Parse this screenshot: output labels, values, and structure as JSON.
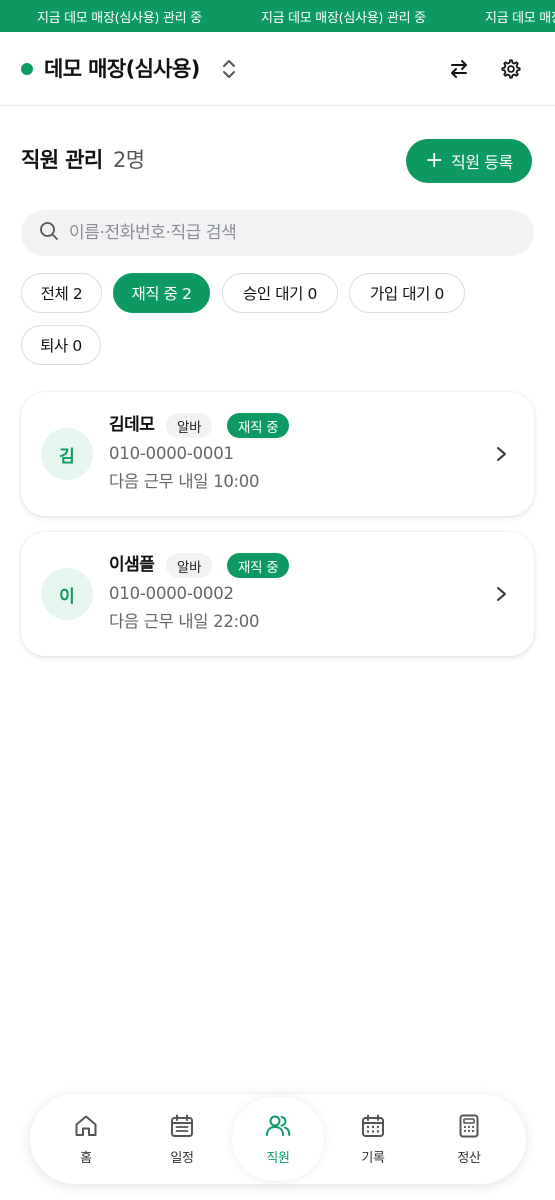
{
  "banner": {
    "items": [
      "지금 데모 매장(심사용) 관리 중",
      "지금 데모 매장(심사용) 관리 중",
      "지금 데모 매장(심사용) 관리 중"
    ]
  },
  "header": {
    "store_name": "데모 매장(심사용)",
    "switch_icon": "swap-arrows-icon",
    "settings_icon": "gear-icon"
  },
  "page": {
    "title": "직원 관리",
    "count": "2명",
    "add_button_label": "직원 등록"
  },
  "search": {
    "placeholder": "이름·전화번호·직급 검색",
    "value": ""
  },
  "filters": [
    {
      "label": "전체 2",
      "active": false
    },
    {
      "label": "재직 중 2",
      "active": true
    },
    {
      "label": "승인 대기 0",
      "active": false
    },
    {
      "label": "가입 대기 0",
      "active": false
    },
    {
      "label": "퇴사 0",
      "active": false
    }
  ],
  "employees": [
    {
      "initial": "김",
      "name": "김데모",
      "role": "알바",
      "status": "재직 중",
      "phone": "010-0000-0001",
      "next_shift": "다음 근무 내일 10:00"
    },
    {
      "initial": "이",
      "name": "이샘플",
      "role": "알바",
      "status": "재직 중",
      "phone": "010-0000-0002",
      "next_shift": "다음 근무 내일 22:00"
    }
  ],
  "nav": {
    "items": [
      {
        "label": "홈",
        "icon": "home-icon",
        "active": false
      },
      {
        "label": "일정",
        "icon": "calendar-icon",
        "active": false
      },
      {
        "label": "직원",
        "icon": "users-icon",
        "active": true
      },
      {
        "label": "기록",
        "icon": "calendar-grid-icon",
        "active": false
      },
      {
        "label": "정산",
        "icon": "calculator-icon",
        "active": false
      }
    ]
  },
  "colors": {
    "accent": "#0c9a62",
    "avatar_bg": "#e6f5ee",
    "chip_bg": "#f1f2f3"
  }
}
